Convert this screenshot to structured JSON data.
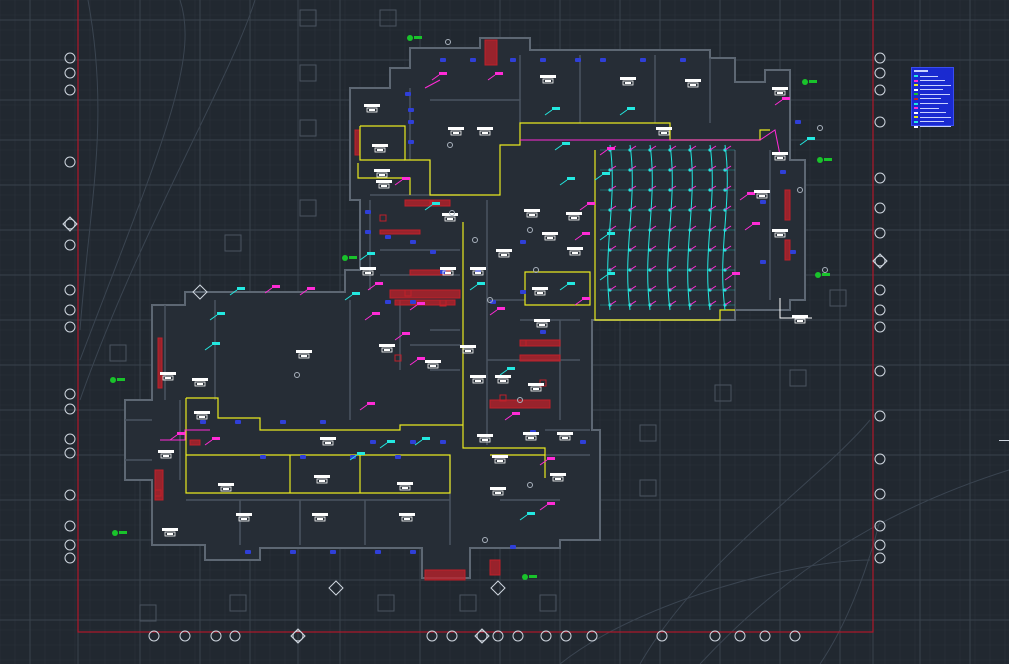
{
  "app": {
    "kind": "cad-drawing-viewer"
  },
  "colors": {
    "background": "#212830",
    "grid_fine": "#2a323b",
    "grid_major": "#39424c",
    "wall": "#4a5460",
    "wall_light": "#5d6773",
    "boundary": "#b0182a",
    "zone": "#e8e820",
    "magenta": "#ff2bd6",
    "cyan": "#23e8e0",
    "blue": "#2f3fd8",
    "red": "#c0202a",
    "green": "#19c32b",
    "white": "#ffffff",
    "legend_bg": "#1a2ad0"
  },
  "legend": {
    "rows": [
      {
        "color": "#23e8e0"
      },
      {
        "color": "#ff2bd6"
      },
      {
        "color": "#e8e820"
      },
      {
        "color": "#ffffff"
      },
      {
        "color": "#19c32b"
      },
      {
        "color": "#c0202a"
      },
      {
        "color": "#23e8e0"
      },
      {
        "color": "#ff2bd6"
      },
      {
        "color": "#ffffff"
      },
      {
        "color": "#e8e820"
      },
      {
        "color": "#23e8e0"
      },
      {
        "color": "#ffffff"
      }
    ]
  }
}
